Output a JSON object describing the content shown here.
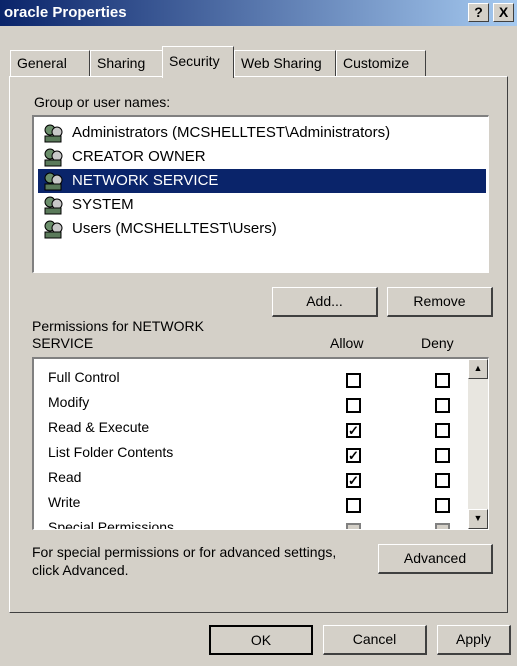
{
  "window": {
    "title": "oracle Properties",
    "help_button": "?",
    "close_button": "X"
  },
  "tabs": [
    {
      "label": "General"
    },
    {
      "label": "Sharing"
    },
    {
      "label": "Security",
      "active": true
    },
    {
      "label": "Web Sharing"
    },
    {
      "label": "Customize"
    }
  ],
  "security": {
    "group_label": "Group or user names:",
    "users": [
      {
        "label": "Administrators (MCSHELLTEST\\Administrators)"
      },
      {
        "label": "CREATOR OWNER"
      },
      {
        "label": "NETWORK SERVICE",
        "selected": true
      },
      {
        "label": "SYSTEM"
      },
      {
        "label": "Users (MCSHELLTEST\\Users)"
      }
    ],
    "add_button": "Add...",
    "remove_button": "Remove",
    "permissions_label_line1": "Permissions for NETWORK",
    "permissions_label_line2": "SERVICE",
    "allow_header": "Allow",
    "deny_header": "Deny",
    "permissions": [
      {
        "name": "Full Control",
        "allow": false,
        "deny": false
      },
      {
        "name": "Modify",
        "allow": false,
        "deny": false
      },
      {
        "name": "Read & Execute",
        "allow": true,
        "deny": false
      },
      {
        "name": "List Folder Contents",
        "allow": true,
        "deny": false
      },
      {
        "name": "Read",
        "allow": true,
        "deny": false
      },
      {
        "name": "Write",
        "allow": false,
        "deny": false
      },
      {
        "name": "Special Permissions",
        "allow": false,
        "deny": false
      }
    ],
    "advanced_text_line1": "For special permissions or for advanced settings,",
    "advanced_text_line2": "click Advanced.",
    "advanced_button": "Advanced"
  },
  "footer": {
    "ok_button": "OK",
    "cancel_button": "Cancel",
    "apply_button": "Apply"
  },
  "colors": {
    "selection": "#0a246a",
    "face": "#d4d0c8"
  }
}
